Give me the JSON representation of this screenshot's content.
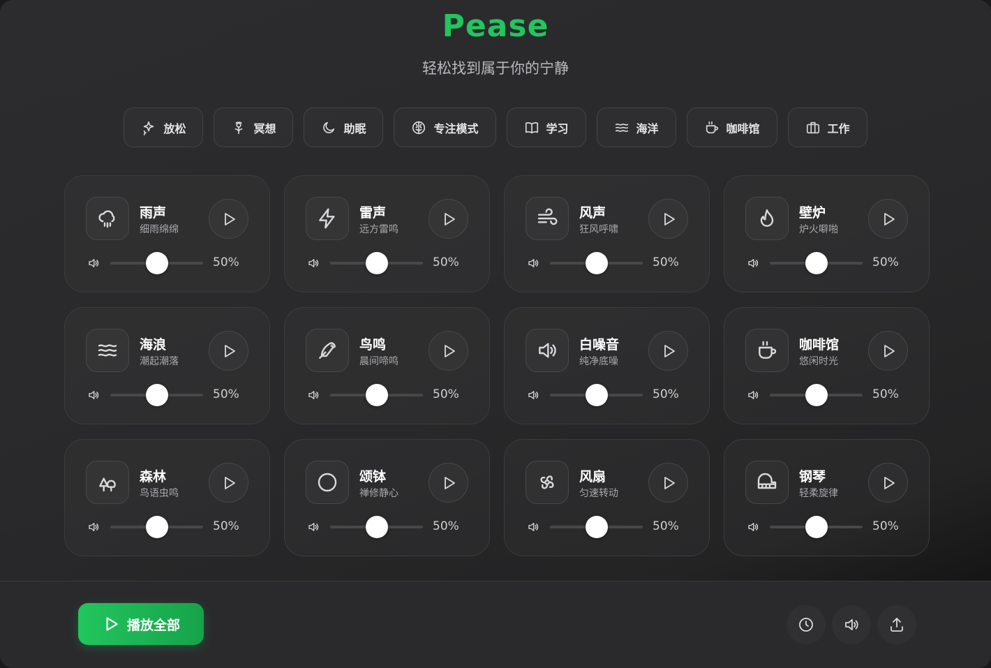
{
  "header": {
    "title": "Pease",
    "subtitle": "轻松找到属于你的宁静"
  },
  "categories": [
    {
      "label": "放松",
      "icon": "sparkles-icon"
    },
    {
      "label": "冥想",
      "icon": "flower-icon"
    },
    {
      "label": "助眠",
      "icon": "moon-icon"
    },
    {
      "label": "专注模式",
      "icon": "brain-icon"
    },
    {
      "label": "学习",
      "icon": "book-icon"
    },
    {
      "label": "海洋",
      "icon": "waves-icon"
    },
    {
      "label": "咖啡馆",
      "icon": "coffee-icon"
    },
    {
      "label": "工作",
      "icon": "briefcase-icon"
    }
  ],
  "sounds": [
    {
      "name": "雨声",
      "desc": "细雨绵绵",
      "icon": "cloud-rain-icon",
      "volume": 50,
      "volume_label": "50%"
    },
    {
      "name": "雷声",
      "desc": "远方雷鸣",
      "icon": "lightning-icon",
      "volume": 50,
      "volume_label": "50%"
    },
    {
      "name": "风声",
      "desc": "狂风呼啸",
      "icon": "wind-icon",
      "volume": 50,
      "volume_label": "50%"
    },
    {
      "name": "壁炉",
      "desc": "炉火噼啪",
      "icon": "flame-icon",
      "volume": 50,
      "volume_label": "50%"
    },
    {
      "name": "海浪",
      "desc": "潮起潮落",
      "icon": "waves-icon",
      "volume": 50,
      "volume_label": "50%"
    },
    {
      "name": "鸟鸣",
      "desc": "晨间啼鸣",
      "icon": "bird-icon",
      "volume": 50,
      "volume_label": "50%"
    },
    {
      "name": "白噪音",
      "desc": "纯净底噪",
      "icon": "speaker-icon",
      "volume": 50,
      "volume_label": "50%"
    },
    {
      "name": "咖啡馆",
      "desc": "悠闲时光",
      "icon": "coffee-icon",
      "volume": 50,
      "volume_label": "50%"
    },
    {
      "name": "森林",
      "desc": "鸟语虫鸣",
      "icon": "trees-icon",
      "volume": 50,
      "volume_label": "50%"
    },
    {
      "name": "颂钵",
      "desc": "禅修静心",
      "icon": "circle-icon",
      "volume": 50,
      "volume_label": "50%"
    },
    {
      "name": "风扇",
      "desc": "匀速转动",
      "icon": "fan-icon",
      "volume": 50,
      "volume_label": "50%"
    },
    {
      "name": "钢琴",
      "desc": "轻柔旋律",
      "icon": "piano-icon",
      "volume": 50,
      "volume_label": "50%"
    }
  ],
  "footer": {
    "play_all_label": "播放全部",
    "buttons": [
      {
        "icon": "clock-icon"
      },
      {
        "icon": "volume-icon"
      },
      {
        "icon": "share-icon"
      }
    ]
  },
  "colors": {
    "accent": "#22c55e",
    "background": "#2a2a2c"
  }
}
